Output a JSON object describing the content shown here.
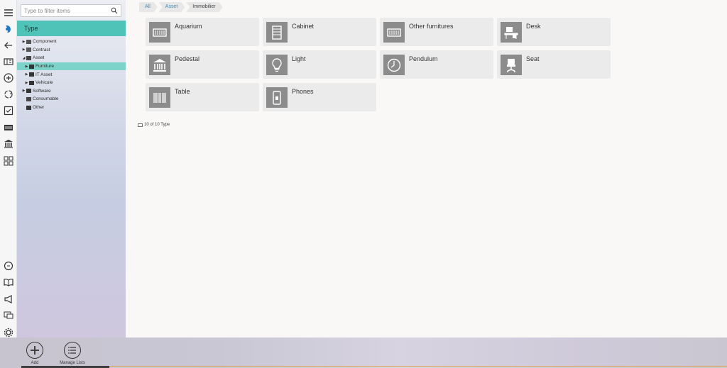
{
  "filter": {
    "placeholder": "Type to filter items"
  },
  "tree_header": "Type",
  "tree": [
    {
      "label": "Component",
      "arrow": "▶",
      "level": 0,
      "icon": "component-icon"
    },
    {
      "label": "Contract",
      "arrow": "▶",
      "level": 0,
      "icon": "contract-icon"
    },
    {
      "label": "Asset",
      "arrow": "◢",
      "level": 0,
      "icon": "asset-icon"
    },
    {
      "label": "Furniture",
      "arrow": "▶",
      "level": 1,
      "icon": "furniture-icon",
      "selected": true
    },
    {
      "label": "IT Asset",
      "arrow": "▶",
      "level": 1,
      "icon": "it-asset-icon"
    },
    {
      "label": "Vehicule",
      "arrow": "▶",
      "level": 1,
      "icon": "vehicle-icon"
    },
    {
      "label": "Software",
      "arrow": "▶",
      "level": 0,
      "icon": "software-icon"
    },
    {
      "label": "Consumable",
      "arrow": "",
      "level": 0,
      "icon": "consumable-icon"
    },
    {
      "label": "Other",
      "arrow": "",
      "level": 0,
      "icon": "home-icon"
    }
  ],
  "breadcrumb": {
    "all": "All",
    "asset": "Asset",
    "current": "Immobilier"
  },
  "tiles": [
    {
      "label": "Aquarium",
      "icon": "aquarium-icon"
    },
    {
      "label": "Cabinet",
      "icon": "cabinet-icon"
    },
    {
      "label": "Other furnitures",
      "icon": "other-furnitures-icon"
    },
    {
      "label": "Desk",
      "icon": "desk-icon"
    },
    {
      "label": "Pedestal",
      "icon": "pedestal-icon"
    },
    {
      "label": "Light",
      "icon": "light-bulb-icon"
    },
    {
      "label": "Pendulum",
      "icon": "clock-icon"
    },
    {
      "label": "Seat",
      "icon": "seat-icon"
    },
    {
      "label": "Table",
      "icon": "table-icon"
    },
    {
      "label": "Phones",
      "icon": "phone-icon"
    }
  ],
  "count_text": "10 of 10 Type",
  "bottom": {
    "add": "Add",
    "manage_lists": "Manage Lists"
  },
  "colors": {
    "accent": "#4fc3b7",
    "selected": "#7dd3ca",
    "link": "#3b8fc6",
    "tile_bg": "#ebebeb",
    "tile_icon_bg": "#8c8c8c"
  }
}
